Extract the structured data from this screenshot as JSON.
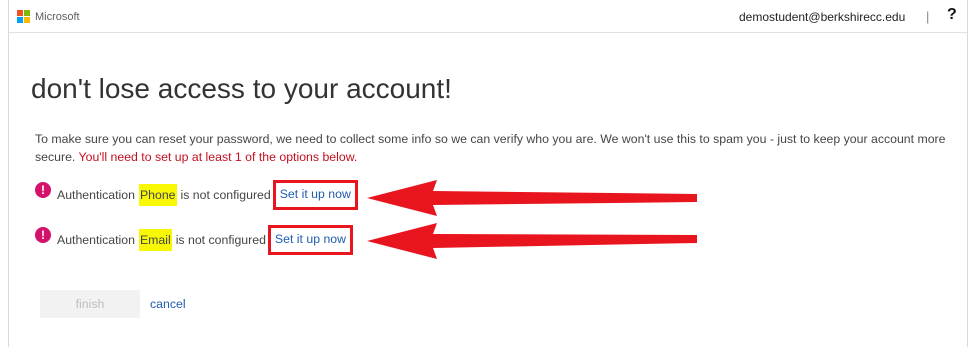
{
  "header": {
    "brand": "Microsoft",
    "user_email": "demostudent@berkshirecc.edu",
    "separator": "|",
    "help_label": "?",
    "logo_colors": [
      "#f25022",
      "#7fba00",
      "#00a4ef",
      "#ffb900"
    ]
  },
  "main": {
    "title": "don't lose access to your account!",
    "intro_text": "To make sure you can reset your password, we need to collect some info so we can verify who you are. We won't use this to spam you - just to keep your account more secure.",
    "required_text": "You'll need to set up at least 1 of the options below.",
    "methods": [
      {
        "prefix": "Authentication",
        "name": "Phone",
        "status": "is not configured",
        "link_label": "Set it up now",
        "icon": "alert-circle-icon"
      },
      {
        "prefix": "Authentication",
        "name": "Email",
        "status": "is not configured",
        "link_label": "Set it up now",
        "icon": "alert-circle-icon"
      }
    ],
    "finish_label": "finish",
    "cancel_label": "cancel"
  },
  "annotation_colors": {
    "box": "#e8141e",
    "arrow": "#e8141e",
    "highlight": "#f8f805"
  }
}
